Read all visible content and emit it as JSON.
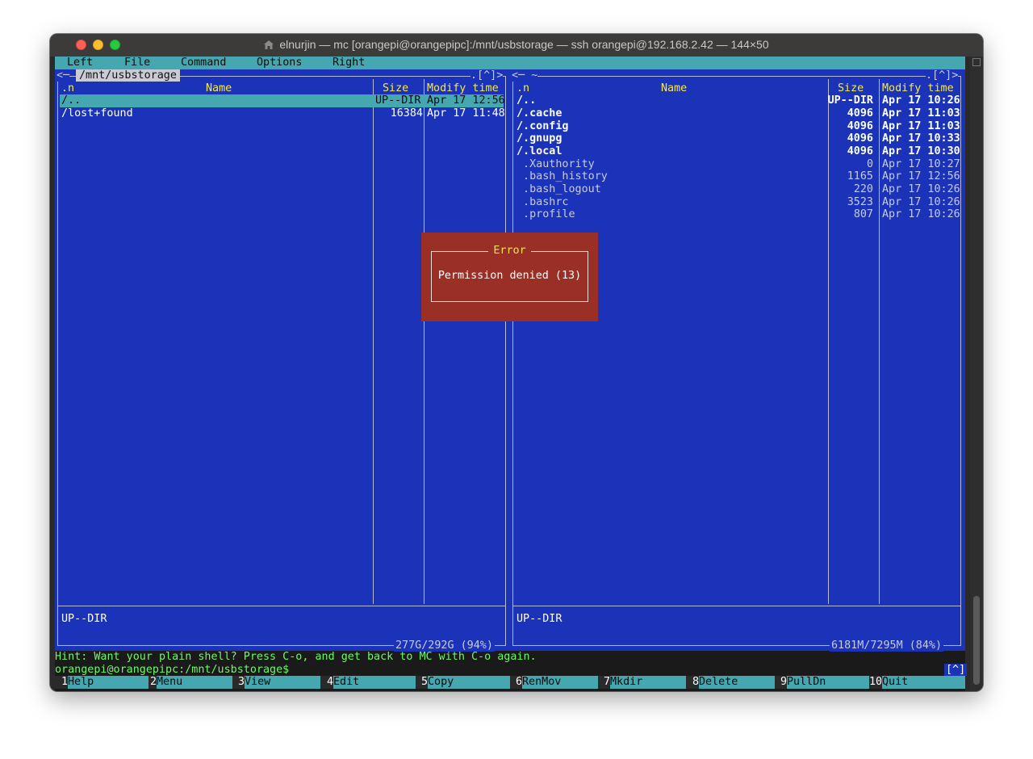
{
  "window": {
    "title": "elnurjin — mc [orangepi@orangepipc]:/mnt/usbstorage — ssh orangepi@192.168.2.42 — 144×50"
  },
  "menu": [
    "Left",
    "File",
    "Command",
    "Options",
    "Right"
  ],
  "left_panel": {
    "path": "/mnt/usbstorage",
    "indicator": ".[^]>",
    "corner": "<─",
    "headers": {
      "n": ".n",
      "name": "Name",
      "size": "Size",
      "time": "Modify time"
    },
    "rows": [
      {
        "name": "/..",
        "size": "UP--DIR",
        "time": "Apr 17 12:56",
        "selected": true
      },
      {
        "name": "/lost+found",
        "size": "16384",
        "time": "Apr 17 11:48"
      }
    ],
    "status": "UP--DIR",
    "disk": "277G/292G (94%)"
  },
  "right_panel": {
    "path": "<─ ~",
    "indicator": ".[^]>",
    "headers": {
      "n": ".n",
      "name": "Name",
      "size": "Size",
      "time": "Modify time"
    },
    "rows": [
      {
        "name": "/..",
        "size": "UP--DIR",
        "time": "Apr 17 10:26",
        "dir": true
      },
      {
        "name": "/.cache",
        "size": "4096",
        "time": "Apr 17 11:03",
        "dir": true
      },
      {
        "name": "/.config",
        "size": "4096",
        "time": "Apr 17 11:03",
        "dir": true
      },
      {
        "name": "/.gnupg",
        "size": "4096",
        "time": "Apr 17 10:33",
        "dir": true
      },
      {
        "name": "/.local",
        "size": "4096",
        "time": "Apr 17 10:30",
        "dir": true
      },
      {
        "name": " .Xauthority",
        "size": "0",
        "time": "Apr 17 10:27",
        "dir": false
      },
      {
        "name": " .bash_history",
        "size": "1165",
        "time": "Apr 17 12:56",
        "dir": false
      },
      {
        "name": " .bash_logout",
        "size": "220",
        "time": "Apr 17 10:26",
        "dir": false
      },
      {
        "name": " .bashrc",
        "size": "3523",
        "time": "Apr 17 10:26",
        "dir": false
      },
      {
        "name": " .profile",
        "size": "807",
        "time": "Apr 17 10:26",
        "dir": false
      }
    ],
    "status": "UP--DIR",
    "disk": "6181M/7295M (84%)"
  },
  "dialog": {
    "title": "Error",
    "message": "Permission denied (13)"
  },
  "hint": "Hint: Want your plain shell? Press C-o, and get back to MC with C-o again.",
  "prompt": "orangepi@orangepipc:/mnt/usbstorage$",
  "corner_button": "[^]",
  "fkeys": [
    {
      "num": "1",
      "label": "Help"
    },
    {
      "num": "2",
      "label": "Menu"
    },
    {
      "num": "3",
      "label": "View"
    },
    {
      "num": "4",
      "label": "Edit"
    },
    {
      "num": "5",
      "label": "Copy"
    },
    {
      "num": "6",
      "label": "RenMov"
    },
    {
      "num": "7",
      "label": "Mkdir"
    },
    {
      "num": "8",
      "label": "Delete"
    },
    {
      "num": "9",
      "label": "PullDn"
    },
    {
      "num": "10",
      "label": "Quit"
    }
  ],
  "colors": {
    "panel_bg": "#1b33b8",
    "menu_bg": "#45a8b0",
    "dialog_bg": "#9a2f26",
    "header_yellow": "#f5e94a",
    "hint_green": "#6ff76a"
  }
}
